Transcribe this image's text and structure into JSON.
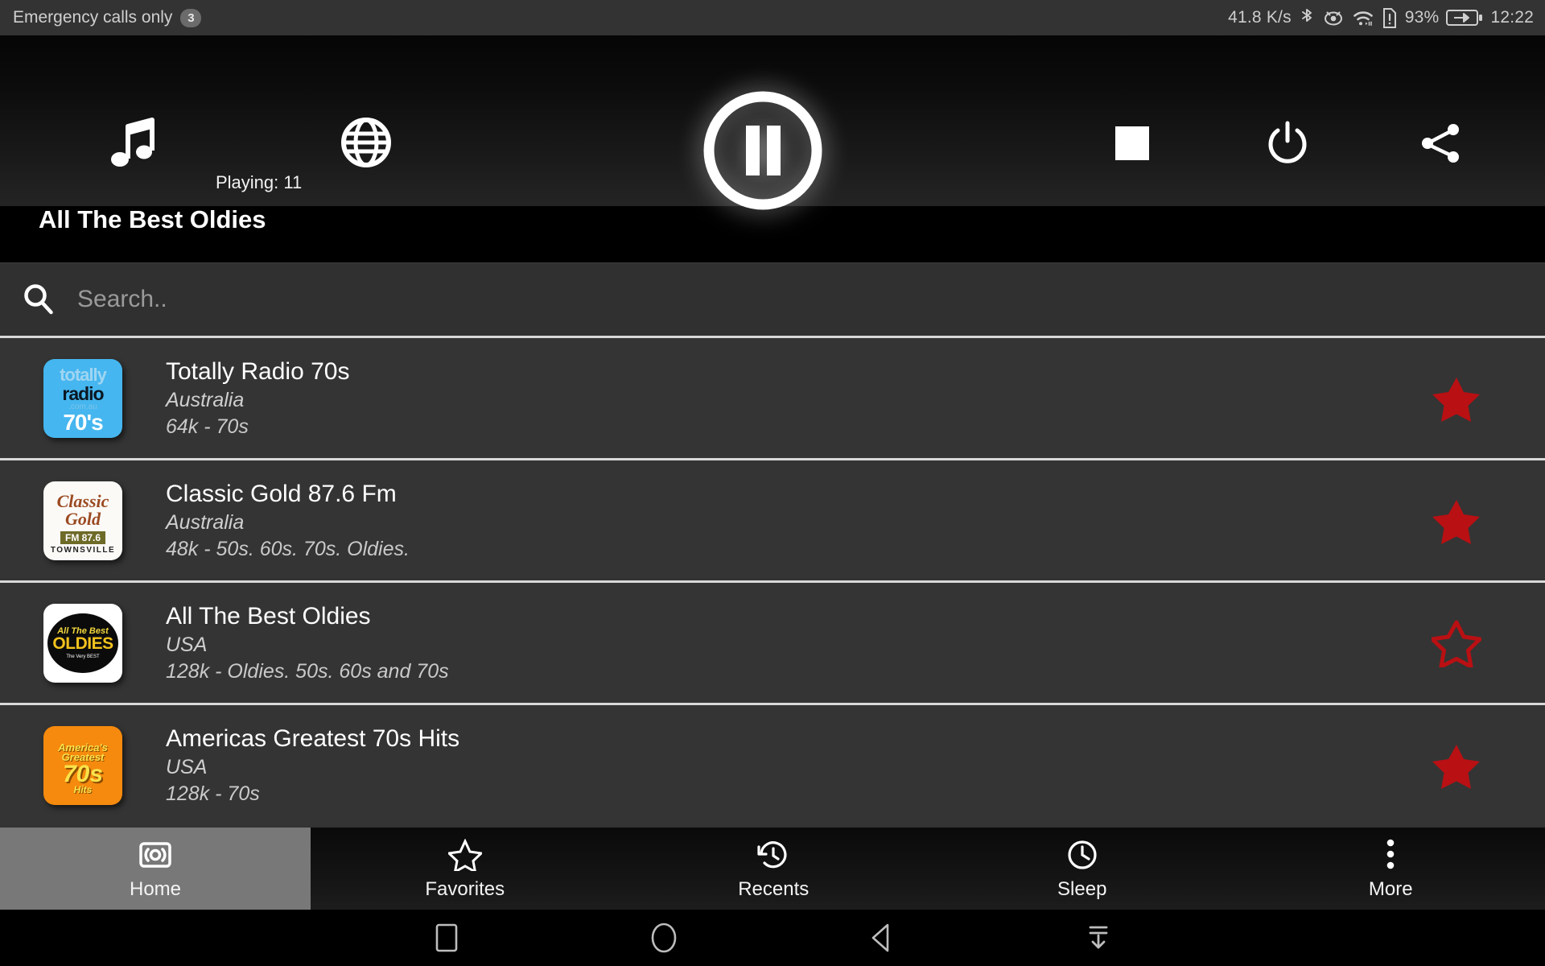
{
  "status_bar": {
    "carrier_text": "Emergency calls only",
    "notification_count": "3",
    "network_speed": "41.8 K/s",
    "battery_percent": "93%",
    "clock": "12:22",
    "icons": [
      "bluetooth-icon",
      "eye-icon",
      "wifi-icon",
      "sim-alert-icon",
      "battery-charging-icon"
    ]
  },
  "player": {
    "music_icon": "music-note-icon",
    "globe_icon": "globe-icon",
    "playing_label": "Playing: 11",
    "pause_icon": "pause-icon",
    "stop_icon": "stop-icon",
    "power_icon": "power-icon",
    "share_icon": "share-icon",
    "now_playing_title": "All The Best Oldies"
  },
  "search": {
    "icon": "search-icon",
    "placeholder": "Search..",
    "value": ""
  },
  "stations": [
    {
      "name": "Totally Radio 70s",
      "country": "Australia",
      "meta": "64k - 70s",
      "favorite": true,
      "logo": {
        "kind": "totally",
        "line1": "totally",
        "line2": "radio",
        "line3": ".com.au",
        "line4": "70's"
      }
    },
    {
      "name": "Classic Gold 87.6 Fm",
      "country": "Australia",
      "meta": "48k - 50s. 60s. 70s. Oldies.",
      "favorite": true,
      "logo": {
        "kind": "classic",
        "line1": "Classic",
        "line2": "Gold",
        "line3": "FM 87.6",
        "line4": "TOWNSVILLE"
      }
    },
    {
      "name": "All The Best Oldies",
      "country": "USA",
      "meta": "128k - Oldies. 50s. 60s and 70s",
      "favorite": false,
      "logo": {
        "kind": "oldies",
        "line1": "All The Best",
        "line2": "OLDIES",
        "line3": "The Very BEST"
      }
    },
    {
      "name": "Americas Greatest 70s Hits",
      "country": "USA",
      "meta": "128k - 70s",
      "favorite": true,
      "logo": {
        "kind": "americas",
        "line1": "America's",
        "line2": "Greatest",
        "line3": "70s",
        "line4": "Hits"
      }
    }
  ],
  "tabs": [
    {
      "label": "Home",
      "icon": "radio-icon",
      "active": true
    },
    {
      "label": "Favorites",
      "icon": "star-icon",
      "active": false
    },
    {
      "label": "Recents",
      "icon": "history-icon",
      "active": false
    },
    {
      "label": "Sleep",
      "icon": "clock-icon",
      "active": false
    },
    {
      "label": "More",
      "icon": "more-vert-icon",
      "active": false
    }
  ],
  "android_nav": [
    {
      "icon": "recents-square-icon"
    },
    {
      "icon": "home-circle-icon"
    },
    {
      "icon": "back-triangle-icon"
    },
    {
      "icon": "hide-navbar-icon"
    }
  ],
  "colors": {
    "favorite_star": "#b91013",
    "list_bg": "#343434",
    "active_tab": "#787878"
  }
}
